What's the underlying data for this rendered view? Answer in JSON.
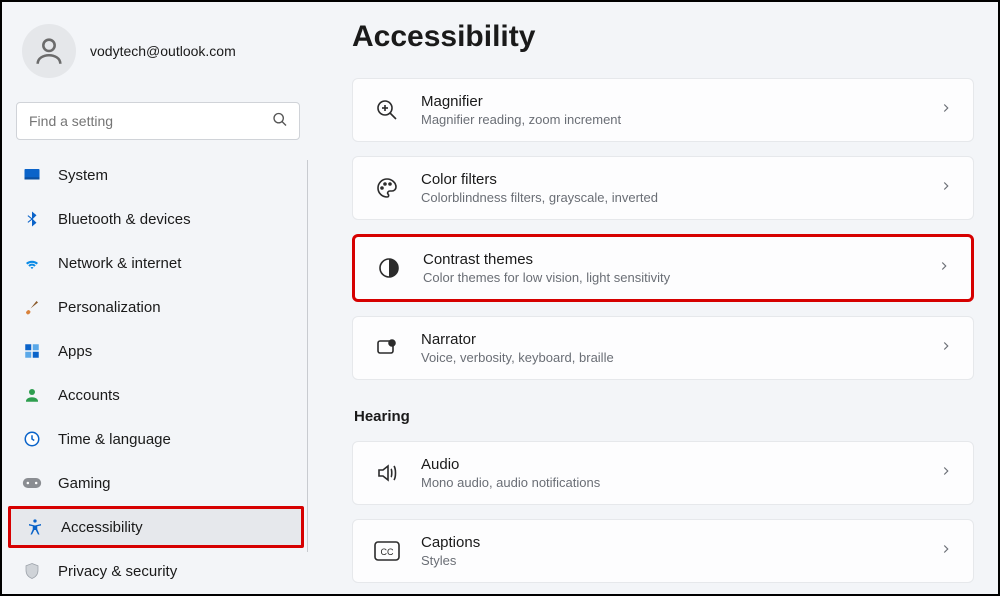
{
  "user": {
    "email": "vodytech@outlook.com"
  },
  "search": {
    "placeholder": "Find a setting"
  },
  "nav": {
    "items": [
      {
        "label": "System"
      },
      {
        "label": "Bluetooth & devices"
      },
      {
        "label": "Network & internet"
      },
      {
        "label": "Personalization"
      },
      {
        "label": "Apps"
      },
      {
        "label": "Accounts"
      },
      {
        "label": "Time & language"
      },
      {
        "label": "Gaming"
      },
      {
        "label": "Accessibility"
      },
      {
        "label": "Privacy & security"
      }
    ]
  },
  "page": {
    "title": "Accessibility",
    "sections": {
      "hearing": "Hearing"
    },
    "cards": [
      {
        "title": "Magnifier",
        "sub": "Magnifier reading, zoom increment"
      },
      {
        "title": "Color filters",
        "sub": "Colorblindness filters, grayscale, inverted"
      },
      {
        "title": "Contrast themes",
        "sub": "Color themes for low vision, light sensitivity"
      },
      {
        "title": "Narrator",
        "sub": "Voice, verbosity, keyboard, braille"
      },
      {
        "title": "Audio",
        "sub": "Mono audio, audio notifications"
      },
      {
        "title": "Captions",
        "sub": "Styles"
      }
    ]
  }
}
